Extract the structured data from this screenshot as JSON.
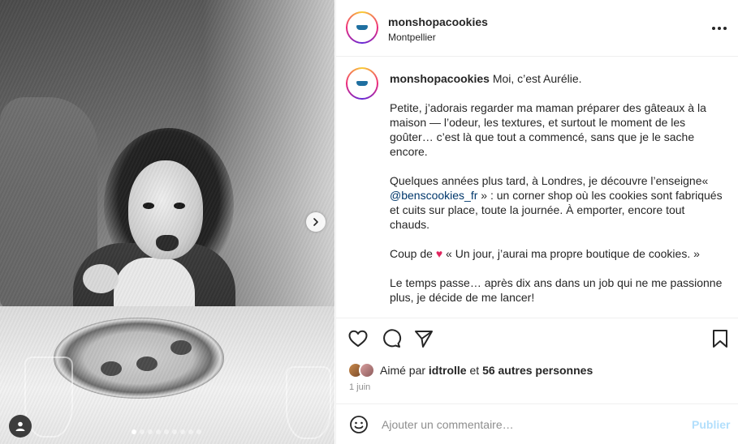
{
  "post": {
    "username": "monshopacookies",
    "location": "Montpellier",
    "avatar_logo_text": "mon shop à cookies"
  },
  "caption": {
    "username": "monshopacookies",
    "intro": "Moi, c’est Aurélie.",
    "p2": "Petite, j’adorais regarder ma maman préparer des gâteaux à la maison — l’odeur, les textures, et surtout le moment de les goûter… c’est là que tout a commencé, sans que je le sache encore.",
    "p3_before": "Quelques années plus tard, à Londres, je découvre l’enseigne« ",
    "p3_mention": "@benscookies_fr",
    "p3_after": " » : un corner shop où les cookies sont fabriqués et cuits sur place, toute la journée. À emporter, encore tout chauds.",
    "p4_before": "Coup de ",
    "p4_emoji": "♥",
    "p4_after": "  «  Un jour, j’aurai ma propre boutique de cookies. »",
    "p5": "Le temps passe… après dix ans dans un job qui ne me passionne plus, je décide de me lancer!"
  },
  "likes": {
    "prefix": "Aimé par ",
    "user": "idtrolle",
    "middle": " et ",
    "others": "56 autres personnes"
  },
  "date": "1 juin",
  "comment_box": {
    "placeholder": "Ajouter un commentaire…",
    "publish_label": "Publier"
  },
  "carousel": {
    "total": 9,
    "current": 1
  },
  "icons": {
    "like": "heart-icon",
    "comment": "comment-bubble-icon",
    "share": "paper-plane-icon",
    "save": "bookmark-icon",
    "next": "chevron-right-icon",
    "tag": "user-tag-icon",
    "emoji": "smiley-icon",
    "more": "more-options-icon"
  },
  "colors": {
    "link": "#00376b",
    "publish_disabled": "#b2dffc",
    "heart": "#e0245e"
  }
}
